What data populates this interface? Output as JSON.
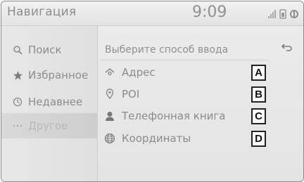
{
  "header": {
    "title": "Навигация",
    "time": "9:09",
    "status_icons": [
      "signal-icon",
      "battery-icon",
      "wifi-icon"
    ]
  },
  "sidebar": {
    "items": [
      {
        "label": "Поиск",
        "icon": "search-icon"
      },
      {
        "label": "Избранное",
        "icon": "star-icon"
      },
      {
        "label": "Недавнее",
        "icon": "clock-icon"
      },
      {
        "label": "Другое",
        "icon": "more-icon",
        "active": true
      }
    ]
  },
  "main": {
    "prompt": "Выберите способ ввода",
    "back_icon": "back-arrow-icon",
    "options": [
      {
        "label": "Адрес",
        "icon": "address-icon",
        "marker": "A"
      },
      {
        "label": "POI",
        "icon": "poi-pin-icon",
        "marker": "B"
      },
      {
        "label": "Телефонная книга",
        "icon": "person-icon",
        "marker": "C"
      },
      {
        "label": "Координаты",
        "icon": "globe-icon",
        "marker": "D"
      }
    ]
  }
}
